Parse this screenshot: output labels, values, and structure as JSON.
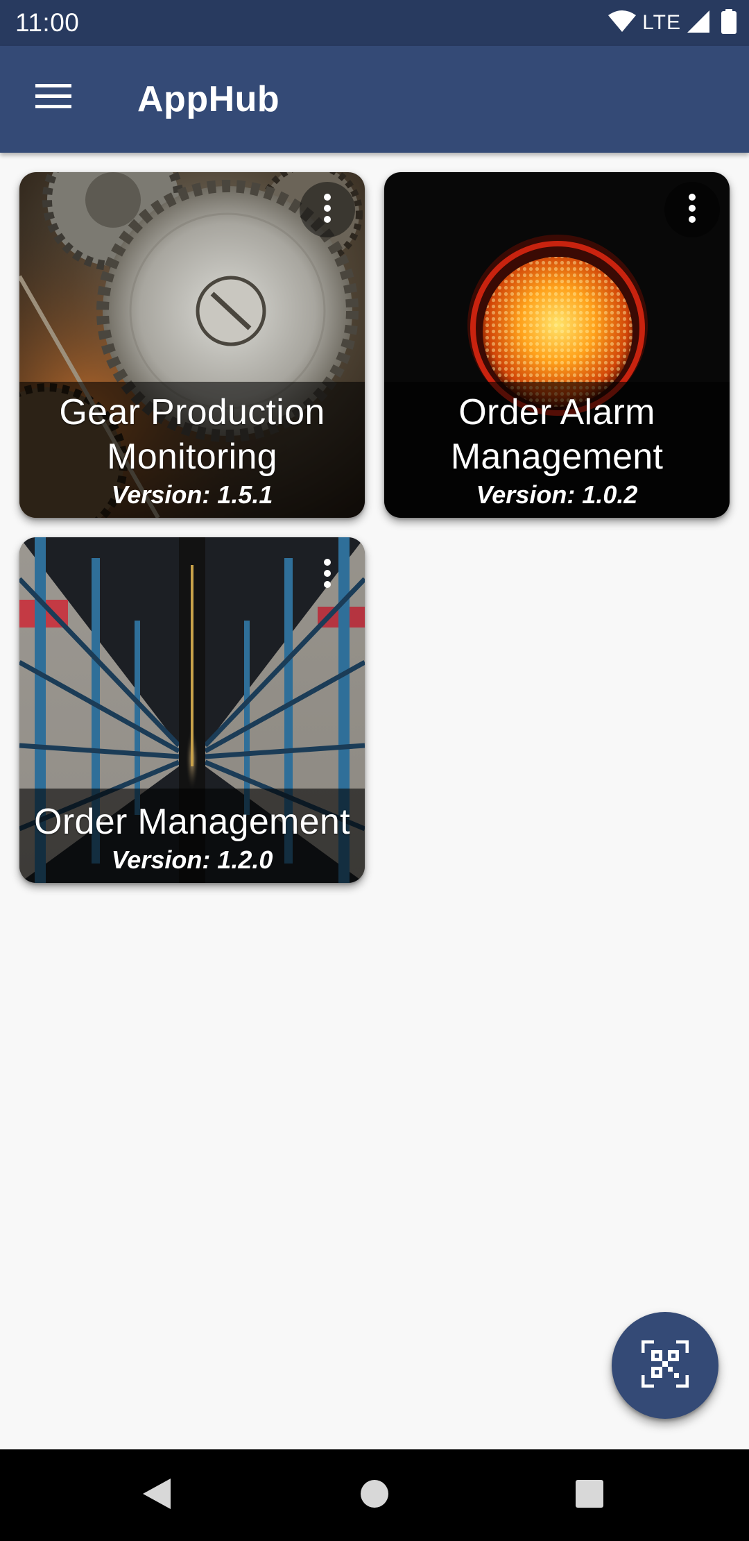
{
  "status_bar": {
    "time": "11:00",
    "network": "LTE"
  },
  "app_bar": {
    "title": "AppHub",
    "menu_icon": "hamburger-menu-icon"
  },
  "apps": [
    {
      "title": "Gear Production Monitoring",
      "version": "Version: 1.5.1",
      "image": "gears-photo",
      "menu_icon": "more-vertical-icon"
    },
    {
      "title": "Order Alarm Management",
      "version": "Version: 1.0.2",
      "image": "traffic-light-photo",
      "menu_icon": "more-vertical-icon"
    },
    {
      "title": "Order Management",
      "version": "Version: 1.2.0",
      "image": "warehouse-aisle-photo",
      "menu_icon": "more-vertical-icon"
    }
  ],
  "fab": {
    "icon": "qr-code-scan-icon"
  },
  "nav_bar": {
    "back_icon": "back-triangle-icon",
    "home_icon": "home-circle-icon",
    "recents_icon": "recents-square-icon"
  },
  "colors": {
    "status_bar": "#283a5f",
    "primary": "#344a76",
    "background": "#f8f8f8",
    "nav_bar": "#000000"
  }
}
